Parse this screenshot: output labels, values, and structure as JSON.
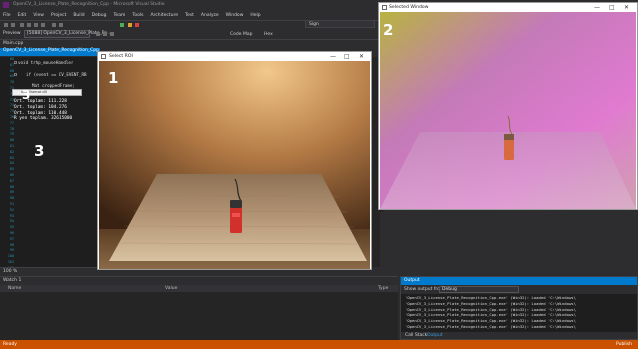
{
  "vs": {
    "window_title": "OpenCV_3_License_Plate_Recognition_Cpp - Microsoft Visual Studio",
    "menu": [
      "File",
      "Edit",
      "View",
      "Project",
      "Build",
      "Debug",
      "Team",
      "Tools",
      "Architecture",
      "Test",
      "Analyze",
      "Window",
      "Help"
    ],
    "quick_launch": "Sign",
    "preview_label": "Preview",
    "preview_dropdown": "[5088] OpenCV_3_License_Plate_Re...",
    "code_map": "Code Map",
    "hex": "Hex",
    "doc_tab": "Main.cpp",
    "doc_file": "OpenCV_3_License_Plate_Recognition_Cpp",
    "zoom": "100 %"
  },
  "editor": {
    "line_numbers": [
      "66",
      "67",
      "68",
      "69",
      "70",
      "71",
      "72",
      "73",
      "74",
      "75",
      "76",
      "77",
      "78",
      "79",
      "80",
      "81",
      "82",
      "83",
      "84",
      "85",
      "86",
      "87",
      "88",
      "89",
      "90",
      "91",
      "92",
      "93",
      "94",
      "95",
      "96",
      "97",
      "98",
      "99",
      "100",
      "101",
      "102",
      "103",
      "104",
      "105",
      "106",
      "107",
      "108"
    ],
    "code": {
      "line1": "void trhp_mouseHandler",
      "line2": "if (event == CV_EVENT_RB",
      "line3": "Mat croppedFrame;"
    },
    "intellisense": "Intellisense.dll",
    "console": [
      "Ort. toplam:  111.228",
      "Ort. toplam:  104.276",
      "Ort. toplam:  110.448",
      "R yen toplam. 32615080"
    ]
  },
  "roi_window": {
    "title": "Select ROI",
    "minimize": "—",
    "maximize": "□",
    "close": "✕"
  },
  "selected_window": {
    "title": "Selected Window",
    "minimize": "—",
    "maximize": "□",
    "close": "✕"
  },
  "watch": {
    "title": "Watch 1",
    "col_name": "Name",
    "col_value": "Value",
    "col_type": "Type"
  },
  "output": {
    "title": "Output",
    "show_label": "Show output from:",
    "source": "Debug",
    "lines": [
      "'OpenCV_3_License_Plate_Recognition_Cpp.exe' (Win32): Loaded 'C:\\Windows\\",
      "'OpenCV_3_License_Plate_Recognition_Cpp.exe' (Win32): Loaded 'C:\\Windows\\",
      "'OpenCV_3_License_Plate_Recognition_Cpp.exe' (Win32): Loaded 'C:\\Windows\\",
      "'OpenCV_3_License_Plate_Recognition_Cpp.exe' (Win32): Loaded 'C:\\Windows\\",
      "'OpenCV_3_License_Plate_Recognition_Cpp.exe' (Win32): Loaded 'C:\\Windows\\",
      "'OpenCV_3_License_Plate_Recognition_Cpp.exe' (Win32): Loaded 'C:\\Windows\\"
    ],
    "tab_call_stack": "Call Stack",
    "tab_output": "Output"
  },
  "status": {
    "left": "Ready",
    "right": "Publish"
  },
  "callouts": {
    "c1": "1",
    "c2": "2",
    "c3": "3"
  },
  "colors": {
    "accent": "#007acc",
    "status_bar": "#ca5100",
    "editor_bg": "#1e1e1e"
  }
}
